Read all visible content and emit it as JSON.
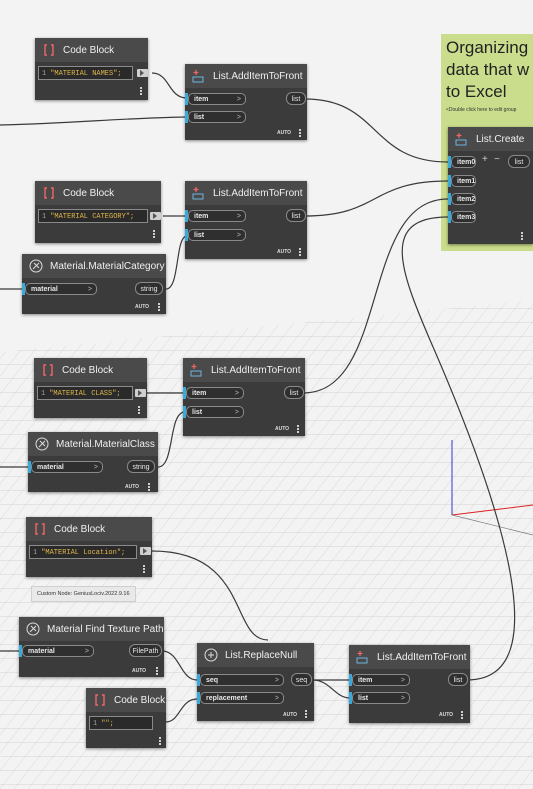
{
  "group": {
    "title_lines": [
      "Organizing",
      "data that w",
      "to Excel"
    ],
    "hint": "<Double click here to edit group"
  },
  "custom_node_tag": "Custom Node: GeniusLociv.2022.9.16",
  "auto_label": "AUTO",
  "code_blocks": [
    {
      "title": "Code Block",
      "line_no": "1",
      "code": "\"MATERIAL NAMES\";"
    },
    {
      "title": "Code Block",
      "line_no": "1",
      "code": "\"MATERIAL CATEGORY\";"
    },
    {
      "title": "Code Block",
      "line_no": "1",
      "code": "\"MATERIAL CLASS\";"
    },
    {
      "title": "Code Block",
      "line_no": "1",
      "code": "\"MATERIAL Location\";"
    },
    {
      "title": "Code Block",
      "line_no": "1",
      "code": "\"\";"
    }
  ],
  "add_item_nodes": [
    {
      "title": "List.AddItemToFront",
      "in1": "item",
      "in2": "list",
      "out": "list"
    },
    {
      "title": "List.AddItemToFront",
      "in1": "item",
      "in2": "list",
      "out": "list"
    },
    {
      "title": "List.AddItemToFront",
      "in1": "item",
      "in2": "list",
      "out": "list"
    },
    {
      "title": "List.AddItemToFront",
      "in1": "item",
      "in2": "list",
      "out": "list"
    }
  ],
  "material_nodes": [
    {
      "title": "Material.MaterialCategory",
      "in": "material",
      "out": "string"
    },
    {
      "title": "Material.MaterialClass",
      "in": "material",
      "out": "string"
    },
    {
      "title": "Material Find Texture Path",
      "in": "material",
      "out": "FilePath"
    }
  ],
  "replace_null": {
    "title": "List.ReplaceNull",
    "in1": "seq",
    "in2": "replacement",
    "out": "seq"
  },
  "list_create": {
    "title": "List.Create",
    "inputs": [
      "item0",
      "item1",
      "item2",
      "item3"
    ],
    "out": "list",
    "plus": "+",
    "minus": "−"
  },
  "colors": {
    "group": "#c9dd8c",
    "node": "#3b3b3b",
    "header": "#4a4a4a",
    "wire": "#3a3a3a",
    "port_accent": "#39a9d9"
  },
  "icons": [
    "code-block-icon",
    "list-add-icon",
    "material-icon",
    "list-create-icon"
  ]
}
